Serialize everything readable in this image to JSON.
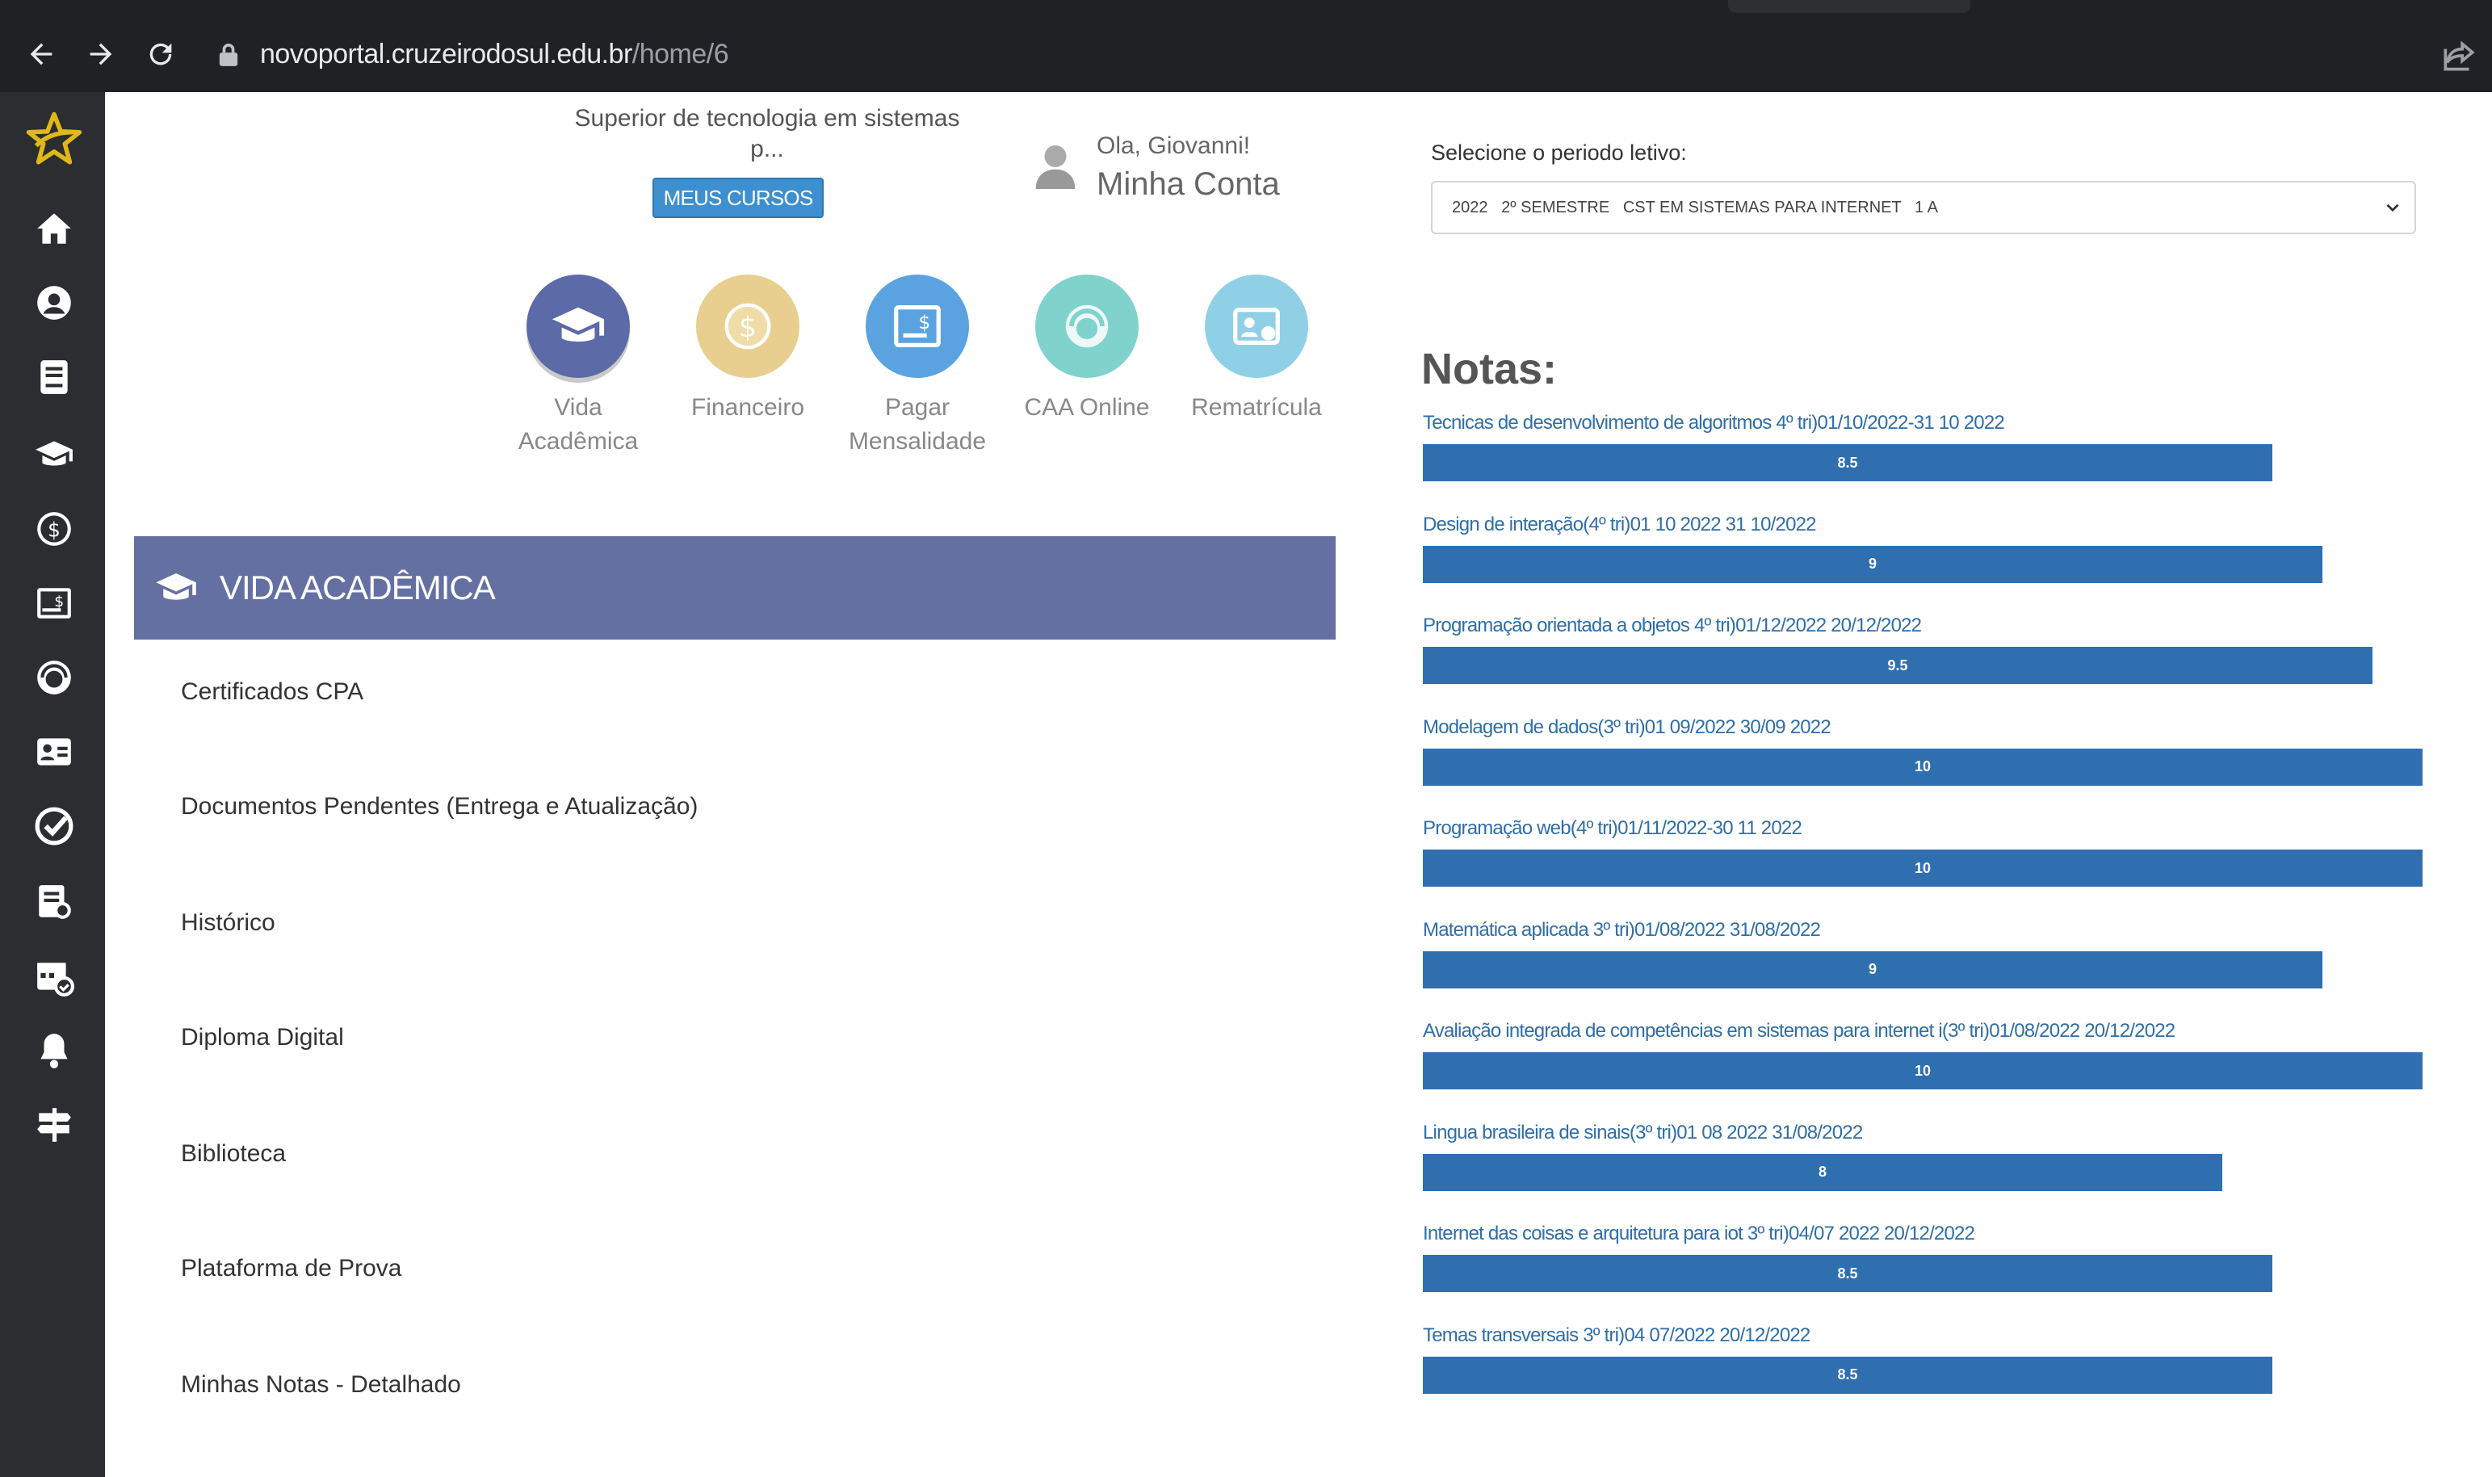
{
  "browser": {
    "url_host": "novoportal.cruzeirodosul.edu.br",
    "url_path": "/home/6"
  },
  "sidebar": {
    "items": [
      {
        "icon": "star-logo-icon"
      },
      {
        "icon": "home-icon"
      },
      {
        "icon": "user-circle-icon"
      },
      {
        "icon": "book-icon"
      },
      {
        "icon": "graduation-cap-icon"
      },
      {
        "icon": "money-icon"
      },
      {
        "icon": "invoice-icon"
      },
      {
        "icon": "support-icon"
      },
      {
        "icon": "id-card-icon"
      },
      {
        "icon": "check-icon"
      },
      {
        "icon": "document-search-icon"
      },
      {
        "icon": "calendar-check-icon"
      },
      {
        "icon": "bell-icon"
      },
      {
        "icon": "signpost-icon"
      }
    ]
  },
  "header": {
    "course_line1": "Superior de tecnologia em sistemas",
    "course_line2": "p...",
    "my_courses_label": "MEUS CURSOS",
    "hello": "Ola, Giovanni!",
    "account": "Minha Conta"
  },
  "quick_links": [
    {
      "label_line1": "Vida",
      "label_line2": "Acadêmica",
      "color": "#5c6aa8",
      "icon": "graduation-cap-icon"
    },
    {
      "label_line1": "Financeiro",
      "label_line2": "",
      "color": "#e8cf8f",
      "icon": "coin-icon"
    },
    {
      "label_line1": "Pagar",
      "label_line2": "Mensalidade",
      "color": "#5aa3e0",
      "icon": "invoice-icon"
    },
    {
      "label_line1": "CAA Online",
      "label_line2": "",
      "color": "#7fd3cc",
      "icon": "support-icon"
    },
    {
      "label_line1": "Rematrícula",
      "label_line2": "",
      "color": "#8fd0e6",
      "icon": "id-card-icon"
    }
  ],
  "vida_academica": {
    "title": "VIDA ACADÊMICA",
    "items": [
      "Certificados CPA",
      "Documentos Pendentes (Entrega e Atualização)",
      "Histórico",
      "Diploma Digital",
      "Biblioteca",
      "Plataforma de Prova",
      "Minhas Notas - Detalhado"
    ]
  },
  "period": {
    "label": "Selecione o periodo letivo:",
    "selected": "2022   2º SEMESTRE   CST EM SISTEMAS PARA INTERNET   1 A"
  },
  "notas": {
    "title": "Notas:",
    "max": 10,
    "accent": "#2f6fb0",
    "grades": [
      {
        "label": "Tecnicas de desenvolvimento de algoritmos 4º tri)01/10/2022-31 10 2022",
        "value": 8.5,
        "display": "8.5"
      },
      {
        "label": "Design de interação(4º tri)01 10 2022 31 10/2022",
        "value": 9,
        "display": "9"
      },
      {
        "label": "Programação orientada a objetos 4º tri)01/12/2022 20/12/2022",
        "value": 9.5,
        "display": "9.5"
      },
      {
        "label": "Modelagem de dados(3º tri)01 09/2022 30/09 2022",
        "value": 10,
        "display": "10"
      },
      {
        "label": "Programação web(4º tri)01/11/2022-30 11 2022",
        "value": 10,
        "display": "10"
      },
      {
        "label": "Matemática aplicada 3º tri)01/08/2022 31/08/2022",
        "value": 9,
        "display": "9"
      },
      {
        "label": "Avaliação integrada de competências em sistemas para internet i(3º tri)01/08/2022 20/12/2022",
        "value": 10,
        "display": "10"
      },
      {
        "label": "Lingua brasileira de sinais(3º tri)01 08 2022 31/08/2022",
        "value": 8,
        "display": "8"
      },
      {
        "label": "Internet das coisas e arquitetura para iot 3º tri)04/07 2022 20/12/2022",
        "value": 8.5,
        "display": "8.5"
      },
      {
        "label": "Temas transversais 3º tri)04 07/2022 20/12/2022",
        "value": 8.5,
        "display": "8.5"
      }
    ]
  }
}
